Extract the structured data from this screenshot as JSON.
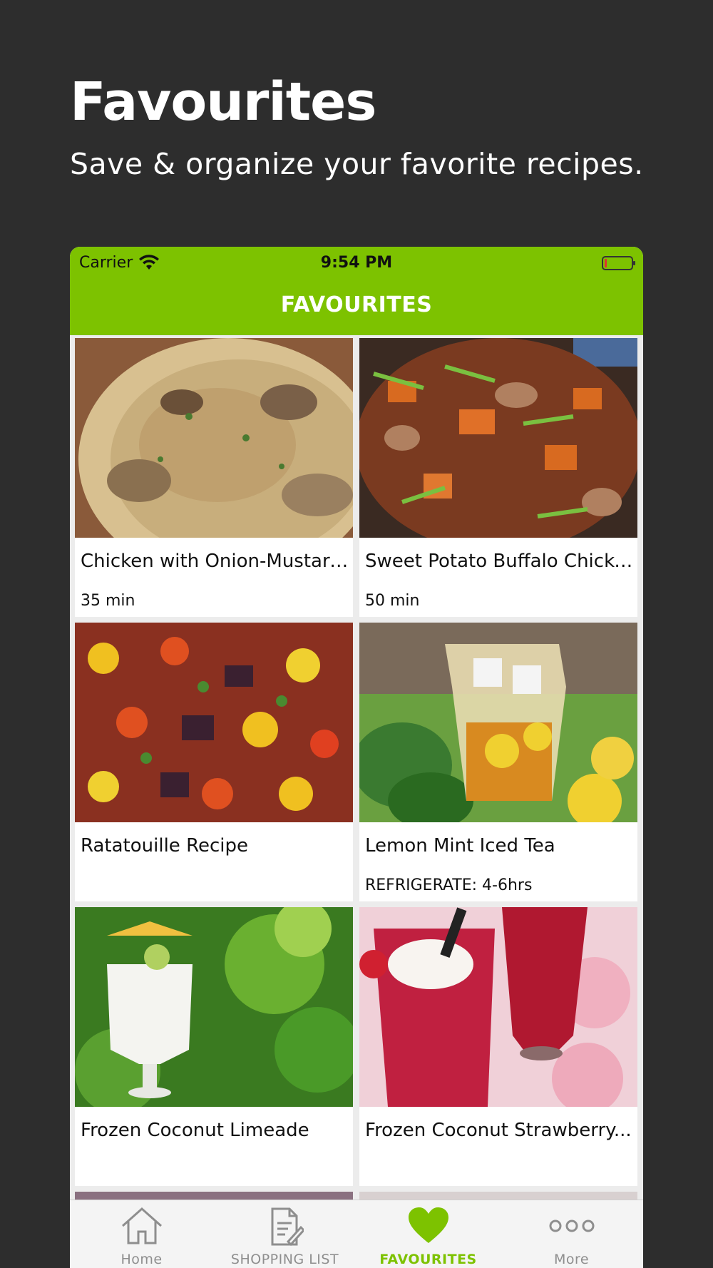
{
  "promo": {
    "title": "Favourites",
    "subtitle": "Save & organize your favorite recipes."
  },
  "status_bar": {
    "carrier": "Carrier",
    "time": "9:54 PM"
  },
  "header": {
    "title": "FAVOURITES"
  },
  "recipes": [
    {
      "title": "Chicken with Onion-Mustard...",
      "meta": "35 min",
      "image": "chicken-mushroom-dish"
    },
    {
      "title": "Sweet Potato Buffalo Chicke...",
      "meta": "50 min",
      "image": "sweet-potato-chicken-skillet"
    },
    {
      "title": "Ratatouille Recipe",
      "meta": "",
      "image": "ratatouille-vegetables"
    },
    {
      "title": "Lemon Mint Iced Tea",
      "meta": "REFRIGERATE: 4-6hrs",
      "image": "iced-tea-pitcher"
    },
    {
      "title": "Frozen Coconut Limeade",
      "meta": "",
      "image": "coconut-limeade-glass"
    },
    {
      "title": "Frozen Coconut Strawberry...",
      "meta": "",
      "image": "strawberry-smoothie-glasses"
    }
  ],
  "tabs": [
    {
      "label": "Home",
      "icon": "home-icon",
      "active": false
    },
    {
      "label": "SHOPPING LIST",
      "icon": "list-icon",
      "active": false
    },
    {
      "label": "FAVOURITES",
      "icon": "heart-icon",
      "active": true
    },
    {
      "label": "More",
      "icon": "more-icon",
      "active": false
    }
  ],
  "colors": {
    "accent": "#7dc200",
    "background": "#2d2d2d"
  }
}
